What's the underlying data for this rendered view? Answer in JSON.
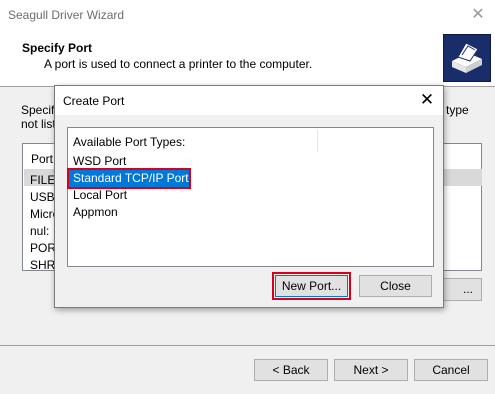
{
  "wizard": {
    "title": "Seagull Driver Wizard",
    "heading": "Specify Port",
    "subheading": "A port is used to connect a printer to the computer.",
    "desc_start": "Specify",
    "desc_line2": "not list",
    "desc_right": "type",
    "list_header": "Port",
    "list_items": [
      "FILE:",
      "USB0",
      "Micro",
      "nul:",
      "PORT",
      "SHRF"
    ],
    "configure_label": "...",
    "back_label": "< Back",
    "next_label": "Next >",
    "cancel_label": "Cancel"
  },
  "dialog": {
    "title": "Create Port",
    "list_header": "Available Port Types:",
    "port_types": [
      "WSD Port",
      "Standard TCP/IP Port",
      "Local Port",
      "Appmon"
    ],
    "selected_index": 1,
    "new_port_label": "New Port...",
    "close_label": "Close"
  },
  "colors": {
    "selection": "#0078d7",
    "highlight_outline": "#d9001b"
  }
}
